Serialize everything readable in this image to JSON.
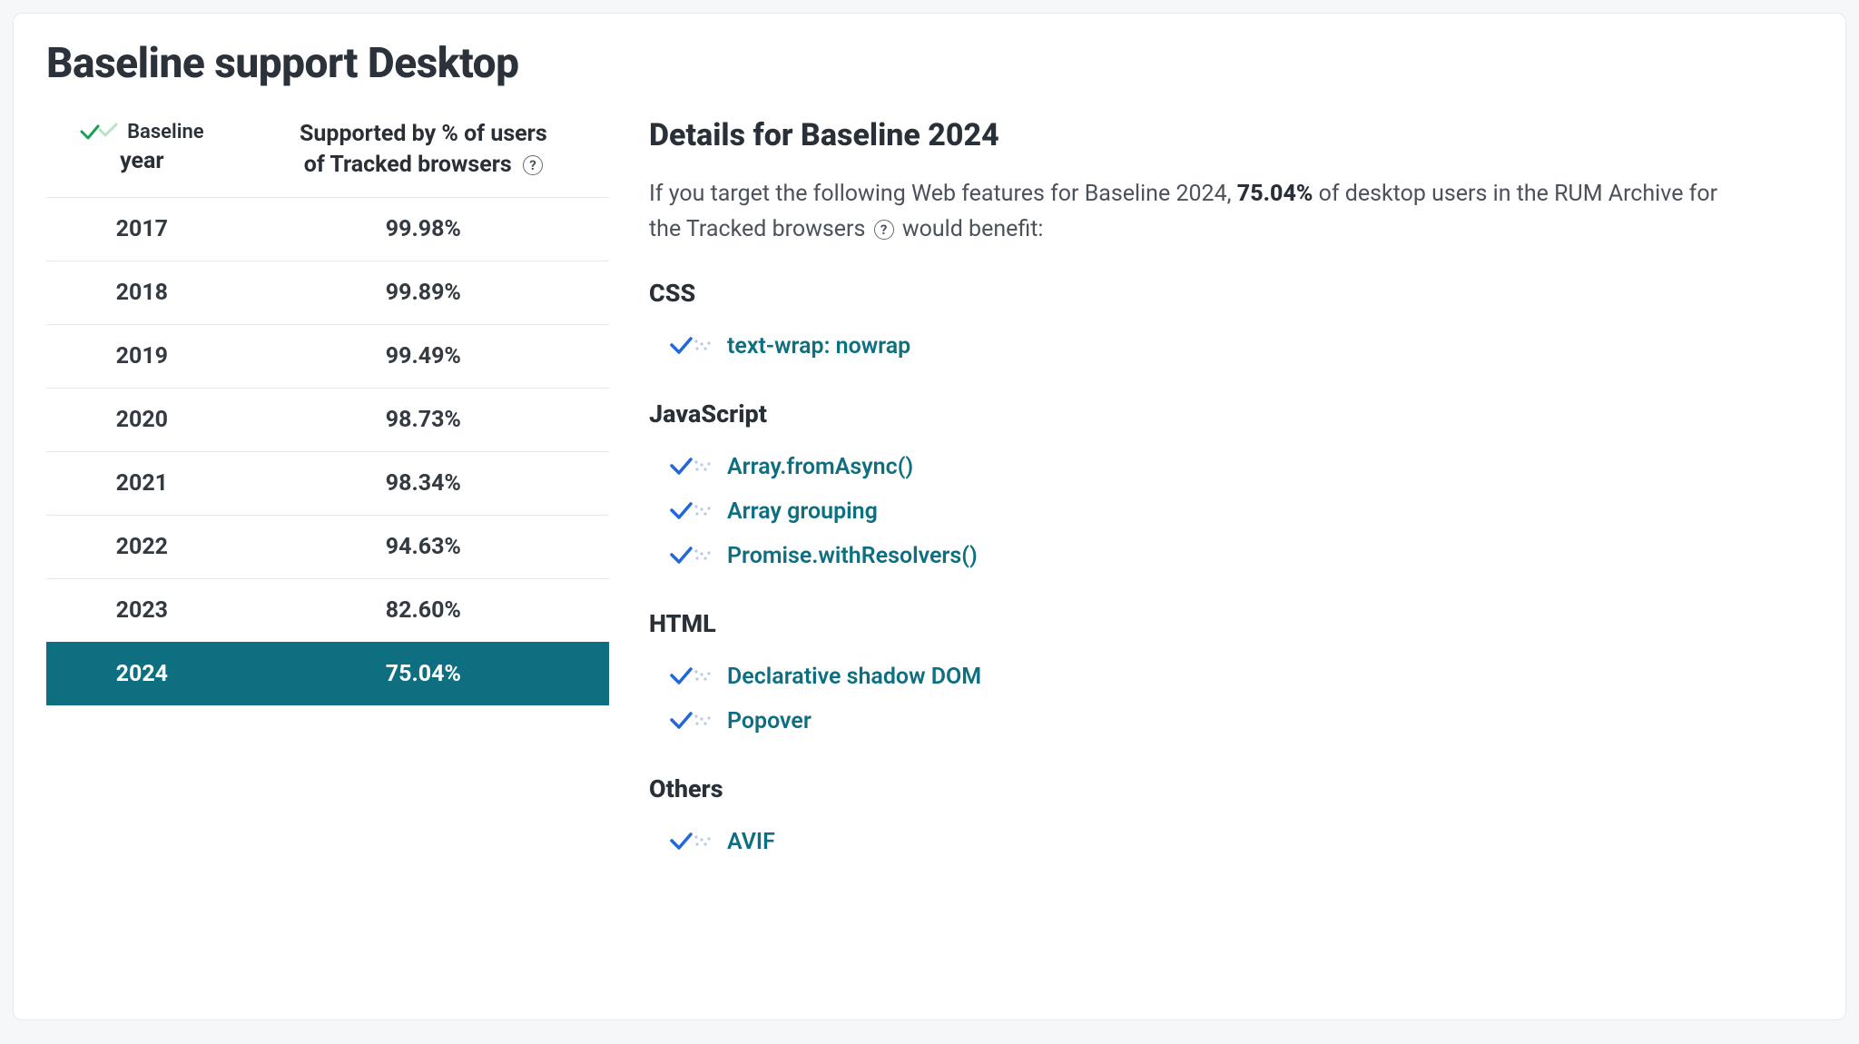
{
  "title": "Baseline support Desktop",
  "table": {
    "header_logo_text": "Baseline",
    "header_col1_line2": "year",
    "header_col2_line1": "Supported by % of users",
    "header_col2_line2": "of Tracked browsers",
    "rows": [
      {
        "year": "2017",
        "pct": "99.98%",
        "selected": false
      },
      {
        "year": "2018",
        "pct": "99.89%",
        "selected": false
      },
      {
        "year": "2019",
        "pct": "99.49%",
        "selected": false
      },
      {
        "year": "2020",
        "pct": "98.73%",
        "selected": false
      },
      {
        "year": "2021",
        "pct": "98.34%",
        "selected": false
      },
      {
        "year": "2022",
        "pct": "94.63%",
        "selected": false
      },
      {
        "year": "2023",
        "pct": "82.60%",
        "selected": false
      },
      {
        "year": "2024",
        "pct": "75.04%",
        "selected": true
      }
    ]
  },
  "details": {
    "heading": "Details for Baseline 2024",
    "desc_pre": "If you target the following Web features for Baseline 2024, ",
    "desc_pct": "75.04%",
    "desc_mid": " of desktop users in the RUM Archive for the Tracked browsers ",
    "desc_post": " would benefit:",
    "categories": [
      {
        "name": "CSS",
        "features": [
          "text-wrap: nowrap"
        ]
      },
      {
        "name": "JavaScript",
        "features": [
          "Array.fromAsync()",
          "Array grouping",
          "Promise.withResolvers()"
        ]
      },
      {
        "name": "HTML",
        "features": [
          "Declarative shadow DOM",
          "Popover"
        ]
      },
      {
        "name": "Others",
        "features": [
          "AVIF"
        ]
      }
    ]
  },
  "chart_data": {
    "type": "table",
    "title": "Baseline support Desktop",
    "columns": [
      "Baseline year",
      "Supported by % of users of Tracked browsers"
    ],
    "rows": [
      [
        "2017",
        99.98
      ],
      [
        "2018",
        99.89
      ],
      [
        "2019",
        99.49
      ],
      [
        "2020",
        98.73
      ],
      [
        "2021",
        98.34
      ],
      [
        "2022",
        94.63
      ],
      [
        "2023",
        82.6
      ],
      [
        "2024",
        75.04
      ]
    ],
    "selected_row_index": 7
  }
}
